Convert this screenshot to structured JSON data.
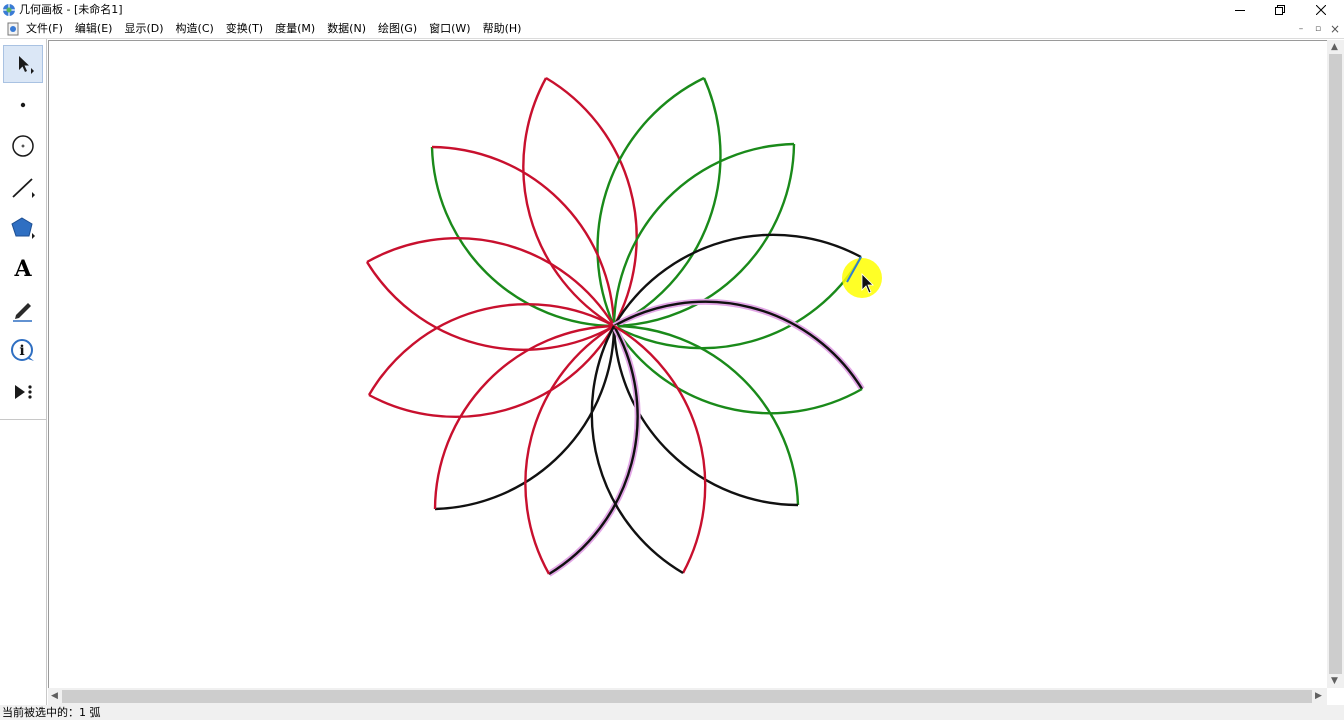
{
  "window": {
    "title": "几何画板 - [未命名1]",
    "controls": {
      "minimize": "—",
      "restore": "❐",
      "close": "✕"
    }
  },
  "menu": {
    "items": [
      "文件(F)",
      "编辑(E)",
      "显示(D)",
      "构造(C)",
      "变换(T)",
      "度量(M)",
      "数据(N)",
      "绘图(G)",
      "窗口(W)",
      "帮助(H)"
    ],
    "mdi_controls": {
      "minimize": "–",
      "restore": "▫",
      "close": "×"
    }
  },
  "toolbox": {
    "tools": [
      {
        "name": "arrow-select-tool",
        "icon": "arrow-select-icon",
        "active": true
      },
      {
        "name": "point-tool",
        "icon": "point-icon",
        "active": false
      },
      {
        "name": "compass-tool",
        "icon": "circle-icon",
        "active": false
      },
      {
        "name": "straightedge-tool",
        "icon": "line-segment-icon",
        "active": false
      },
      {
        "name": "polygon-tool",
        "icon": "pentagon-icon",
        "active": false
      },
      {
        "name": "text-tool",
        "icon": "text-a-icon",
        "label": "A",
        "active": false
      },
      {
        "name": "marker-tool",
        "icon": "pen-icon",
        "active": false
      },
      {
        "name": "information-tool",
        "icon": "info-icon",
        "label": "i",
        "active": false
      },
      {
        "name": "custom-tool",
        "icon": "play-more-icon",
        "active": false
      }
    ]
  },
  "drawing": {
    "description_colors": {
      "red": "#c8102e",
      "green": "#1a8a1a",
      "black": "#111111",
      "selection_highlight": "#e2a6e6",
      "cursor_highlight": "#ffff00"
    }
  },
  "scrollbars": {
    "up": "▲",
    "down": "▼",
    "left": "◀",
    "right": "▶"
  },
  "status": {
    "text": "当前被选中的：1 弧"
  }
}
